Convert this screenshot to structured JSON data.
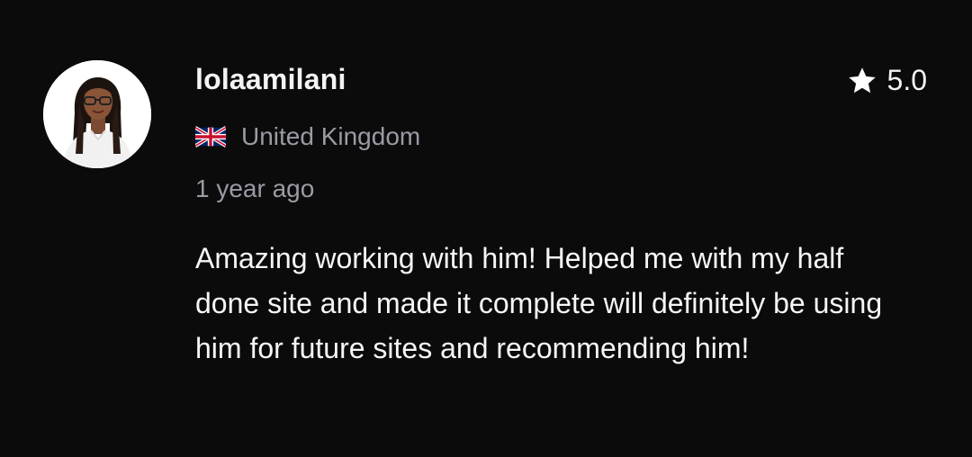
{
  "review": {
    "username": "lolaamilani",
    "rating": "5.0",
    "country_flag": "uk-flag",
    "country": "United Kingdom",
    "time_ago": "1 year ago",
    "text": "Amazing working with him! Helped me with my half done site and made it complete will definitely be using him for future sites and recommending him!"
  },
  "colors": {
    "background": "#0b0b0c",
    "primary_text": "#f3f3f4",
    "secondary_text": "#9a9ba4"
  }
}
